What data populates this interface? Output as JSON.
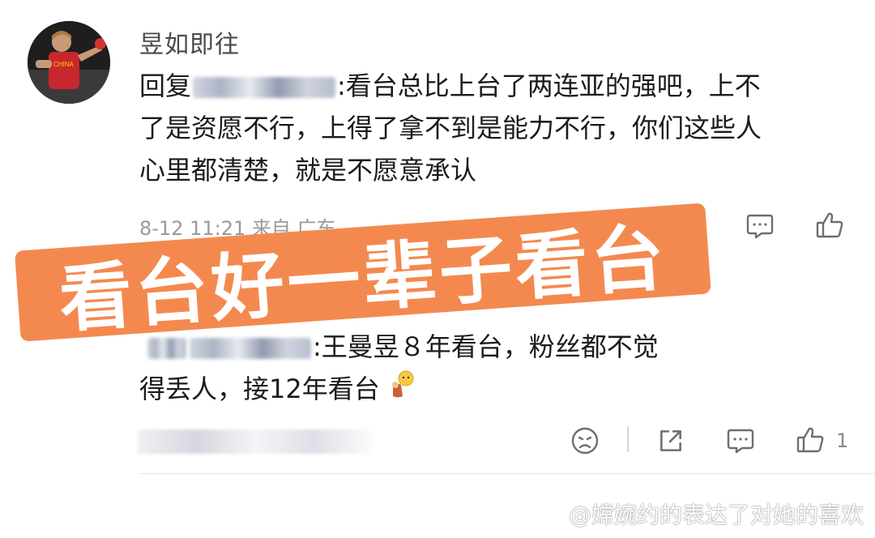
{
  "comment1": {
    "username": "昱如即往",
    "reply_prefix": "回复",
    "line1": ":看台总比上台了两连亚的强吧，上不",
    "line2": "了是资愿不行，上得了拿不到是能力不行，你们这些人",
    "line3": "心里都清楚，就是不愿意承认",
    "meta": "8-12 11:21 来自 广东"
  },
  "comment2": {
    "line1": ":王曼昱８年看台，粉丝都不觉",
    "line2": "得丢人，接12年看台",
    "like_count": "1"
  },
  "banner": {
    "text": "看台好一辈子看台",
    "color": "#f4894f"
  },
  "watermark": {
    "text": "@嫦婉约的表达了对她的喜欢"
  },
  "icons": [
    "avatar",
    "share-icon",
    "comment-icon",
    "like-icon",
    "sad-face-icon",
    "emoji-icon",
    "weibo-logo-icon"
  ]
}
